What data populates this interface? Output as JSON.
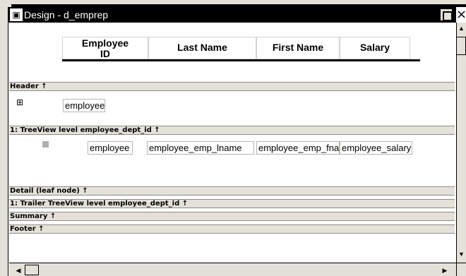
{
  "window": {
    "title": "Design - d_emprep",
    "app_icon": "powerbuilder-datawindow-icon",
    "restore_icon": "restore-icon",
    "close_icon": "close-icon",
    "close_glyph": "×"
  },
  "header_labels": {
    "employee_id": "Employee\nID",
    "last_name": "Last Name",
    "first_name": "First Name",
    "salary": "Salary"
  },
  "bands": {
    "header": "Header ↑",
    "treeview_level": "1: TreeView level employee_dept_id ↑",
    "detail": "Detail (leaf node) ↑",
    "trailer": "1: Trailer TreeView level employee_dept_id ↑",
    "summary": "Summary ↑",
    "footer": "Footer ↑"
  },
  "header_band": {
    "expand_icon": "plus-box-icon",
    "expand_glyph": "⊞",
    "field": "employee"
  },
  "treeview_band": {
    "node_icon": "square-icon",
    "fields": {
      "id": "employee",
      "lname": "employee_emp_lname",
      "fname": "employee_emp_fna",
      "salary": "employee_salary"
    }
  },
  "scrollbars": {
    "up_glyph": "▲",
    "down_glyph": "▼",
    "left_glyph": "◀",
    "right_glyph": "▶"
  },
  "colors": {
    "titlebar": "#000000",
    "band": "#e4e1d8",
    "canvas": "#ffffff"
  }
}
